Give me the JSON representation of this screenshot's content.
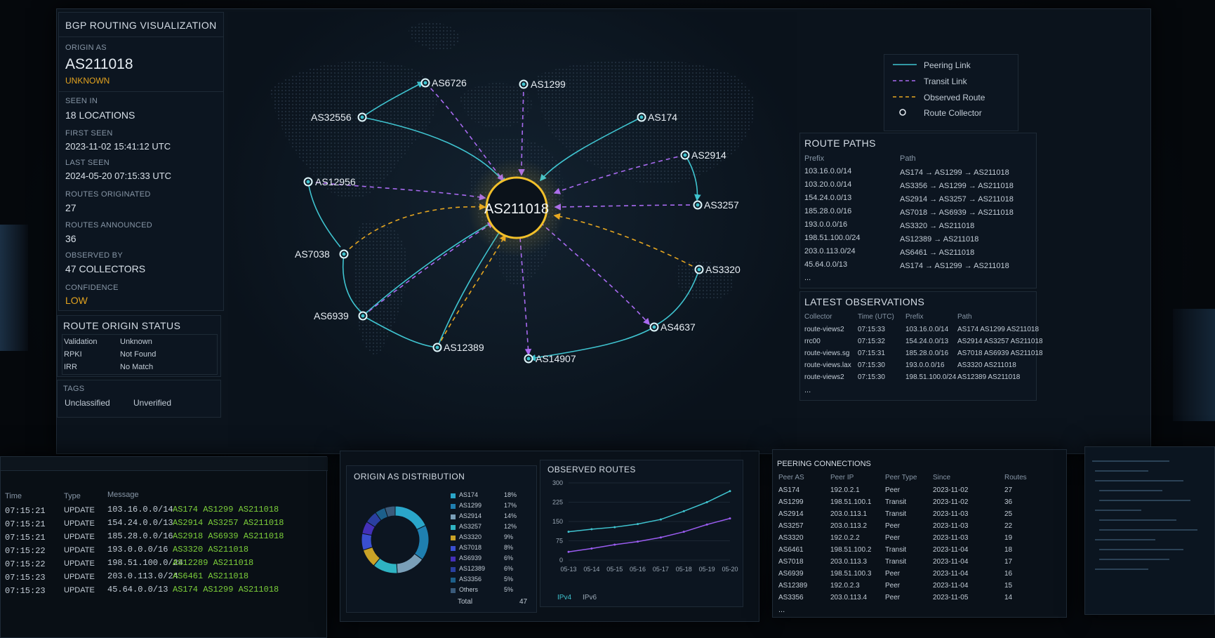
{
  "left": {
    "title": "BGP ROUTING VISUALIZATION",
    "origin_label": "ORIGIN AS",
    "origin_value": "AS211018",
    "origin_status": "UNKNOWN",
    "seen_label": "SEEN IN",
    "seen_value": "18 LOCATIONS",
    "first_label": "FIRST SEEN",
    "first_value": "2023-11-02 15:41:12 UTC",
    "last_label": "LAST SEEN",
    "last_value": "2024-05-20 07:15:33 UTC",
    "orig_label": "ROUTES ORIGINATED",
    "orig_value": "27",
    "ann_label": "ROUTES ANNOUNCED",
    "ann_value": "36",
    "obs_label": "OBSERVED BY",
    "obs_value": "47 COLLECTORS",
    "conf_label": "CONFIDENCE",
    "conf_value": "LOW"
  },
  "ros": {
    "title": "ROUTE ORIGIN STATUS",
    "rows": [
      {
        "k": "Validation",
        "v": "Unknown"
      },
      {
        "k": "RPKI",
        "v": "Not Found"
      },
      {
        "k": "IRR",
        "v": "No Match"
      }
    ]
  },
  "tags": {
    "title": "TAGS",
    "items": [
      "Unclassified",
      "Unverified"
    ]
  },
  "map": {
    "center": "AS211018",
    "nodes": [
      "AS6726",
      "AS1299",
      "AS32556",
      "AS174",
      "AS2914",
      "AS12956",
      "AS3257",
      "AS7038",
      "AS3320",
      "AS6939",
      "AS4637",
      "AS12389",
      "AS14907"
    ]
  },
  "legend": {
    "items": [
      "Peering Link",
      "Transit Link",
      "Observed Route",
      "Route Collector"
    ],
    "colors": {
      "peering": "#3fc3cf",
      "transit": "#a86af0",
      "observed": "#e6a620",
      "ring": "#f2c02a"
    }
  },
  "paths": {
    "title": "ROUTE PATHS",
    "headers": [
      "Prefix",
      "Path"
    ],
    "rows": [
      [
        "103.16.0.0/14",
        "AS174 → AS1299 → AS211018"
      ],
      [
        "103.20.0.0/14",
        "AS3356 → AS1299 → AS211018"
      ],
      [
        "154.24.0.0/13",
        "AS2914 → AS3257 → AS211018"
      ],
      [
        "185.28.0.0/16",
        "AS7018 → AS6939 → AS211018"
      ],
      [
        "193.0.0.0/16",
        "AS3320 → AS211018"
      ],
      [
        "198.51.100.0/24",
        "AS12389 → AS211018"
      ],
      [
        "203.0.113.0/24",
        "AS6461 → AS211018"
      ],
      [
        "45.64.0.0/13",
        "AS174 → AS1299 → AS211018"
      ]
    ],
    "more": "..."
  },
  "latest": {
    "title": "LATEST OBSERVATIONS",
    "headers": [
      "Collector",
      "Time (UTC)",
      "Prefix",
      "Path"
    ],
    "rows": [
      [
        "route-views2",
        "07:15:33",
        "103.16.0.0/14",
        "AS174 AS1299 AS211018"
      ],
      [
        "rrc00",
        "07:15:32",
        "154.24.0.0/13",
        "AS2914 AS3257 AS211018"
      ],
      [
        "route-views.sg",
        "07:15:31",
        "185.28.0.0/16",
        "AS7018 AS6939 AS211018"
      ],
      [
        "route-views.lax",
        "07:15:30",
        "193.0.0.0/16",
        "AS3320 AS211018"
      ],
      [
        "route-views2",
        "07:15:30",
        "198.51.100.0/24",
        "AS12389 AS211018"
      ]
    ],
    "more": "..."
  },
  "log": {
    "headers": [
      "Time",
      "Type",
      "Message"
    ],
    "rows": [
      [
        "07:15:21",
        "UPDATE",
        "103.16.0.0/14",
        "AS174 AS1299 AS211018"
      ],
      [
        "07:15:21",
        "UPDATE",
        "154.24.0.0/13",
        "AS2914 AS3257 AS211018"
      ],
      [
        "07:15:21",
        "UPDATE",
        "185.28.0.0/16",
        "AS2918 AS6939 AS211018"
      ],
      [
        "07:15:22",
        "UPDATE",
        "193.0.0.0/16",
        "AS3320 AS211018"
      ],
      [
        "07:15:22",
        "UPDATE",
        "198.51.100.0/24",
        "AS12289 AS211018"
      ],
      [
        "07:15:23",
        "UPDATE",
        "203.0.113.0/24",
        "AS6461 AS211018"
      ],
      [
        "07:15:23",
        "UPDATE",
        "45.64.0.0/13",
        "AS174 AS1299 AS211018"
      ]
    ]
  },
  "dist": {
    "title": "ORIGIN AS DISTRIBUTION",
    "total_label": "Total",
    "total_value": "47"
  },
  "routes_chart": {
    "title": "OBSERVED ROUTES",
    "legend": [
      "IPv4",
      "IPv6"
    ]
  },
  "peering": {
    "title": "PEERING CONNECTIONS",
    "headers": [
      "Peer AS",
      "Peer IP",
      "Peer Type",
      "Since",
      "Routes"
    ],
    "rows": [
      [
        "AS174",
        "192.0.2.1",
        "Peer",
        "2023-11-02",
        "27"
      ],
      [
        "AS1299",
        "198.51.100.1",
        "Transit",
        "2023-11-02",
        "36"
      ],
      [
        "AS2914",
        "203.0.113.1",
        "Transit",
        "2023-11-03",
        "25"
      ],
      [
        "AS3257",
        "203.0.113.2",
        "Peer",
        "2023-11-03",
        "22"
      ],
      [
        "AS3320",
        "192.0.2.2",
        "Peer",
        "2023-11-03",
        "19"
      ],
      [
        "AS6461",
        "198.51.100.2",
        "Transit",
        "2023-11-04",
        "18"
      ],
      [
        "AS7018",
        "203.0.113.3",
        "Transit",
        "2023-11-04",
        "17"
      ],
      [
        "AS6939",
        "198.51.100.3",
        "Peer",
        "2023-11-04",
        "16"
      ],
      [
        "AS12389",
        "192.0.2.3",
        "Peer",
        "2023-11-04",
        "15"
      ],
      [
        "AS3356",
        "203.0.113.4",
        "Peer",
        "2023-11-05",
        "14"
      ]
    ],
    "more": "..."
  },
  "chart_data": [
    {
      "type": "pie",
      "title": "ORIGIN AS DISTRIBUTION",
      "categories": [
        "AS174",
        "AS1299",
        "AS2914",
        "AS3257",
        "AS3320",
        "AS7018",
        "AS6939",
        "AS12389",
        "AS3356",
        "Others"
      ],
      "values": [
        18,
        17,
        14,
        12,
        9,
        8,
        6,
        6,
        5,
        5
      ],
      "labels": [
        "18%",
        "17%",
        "14%",
        "12%",
        "9%",
        "8%",
        "6%",
        "6%",
        "5%",
        "5%"
      ],
      "colors": [
        "#2aa6c9",
        "#1f7fb0",
        "#7a9fb8",
        "#2fb3c2",
        "#c9a227",
        "#3a4fd0",
        "#4430b8",
        "#2a3fa0",
        "#1c5f8a",
        "#3a5a7a"
      ],
      "total": 47
    },
    {
      "type": "line",
      "title": "OBSERVED ROUTES",
      "x": [
        "05-13",
        "05-14",
        "05-15",
        "05-16",
        "05-17",
        "05-18",
        "05-19",
        "05-20"
      ],
      "ylim": [
        0,
        300
      ],
      "yticks": [
        0,
        75,
        150,
        225,
        300
      ],
      "series": [
        {
          "name": "IPv4",
          "color": "#3fc3cf",
          "values": [
            110,
            120,
            128,
            140,
            158,
            190,
            225,
            268
          ]
        },
        {
          "name": "IPv6",
          "color": "#9a5cf0",
          "values": [
            32,
            45,
            60,
            72,
            88,
            110,
            138,
            162
          ]
        }
      ]
    }
  ]
}
